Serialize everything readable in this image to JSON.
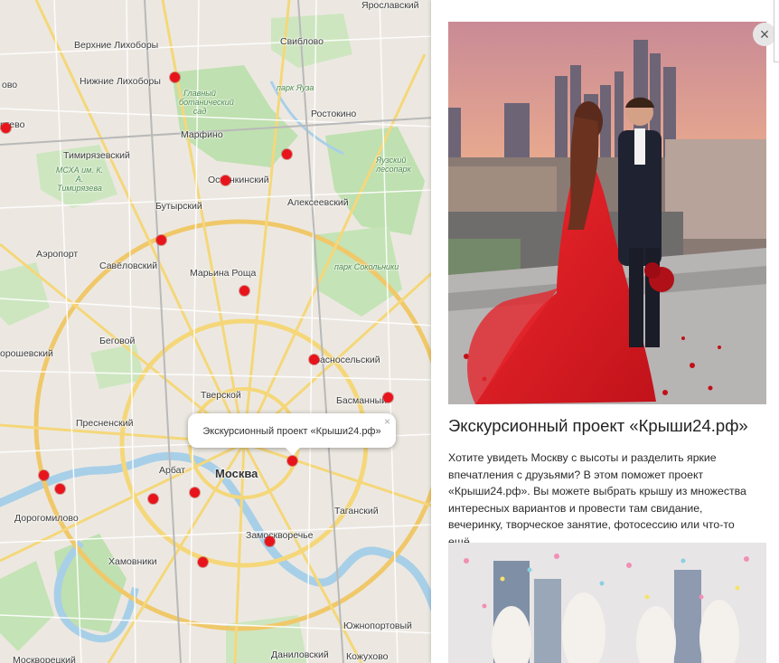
{
  "map": {
    "city_label": "Москва",
    "labels": [
      {
        "text": "Ярославский"
      },
      {
        "text": "Верхние Лихоборы"
      },
      {
        "text": "Свиблово"
      },
      {
        "text": "Нижние Лихоборы"
      },
      {
        "text": "ово"
      },
      {
        "text": "Главный ботанический сад"
      },
      {
        "text": "парк Яуза"
      },
      {
        "text": "Ростокино"
      },
      {
        "text": "ртево"
      },
      {
        "text": "Марфино"
      },
      {
        "text": "Тимирязевский"
      },
      {
        "text": "Останкинский"
      },
      {
        "text": "Яузский лесопарк"
      },
      {
        "text": "МСХА им. К. А. Тимирязева"
      },
      {
        "text": "Алексеевский"
      },
      {
        "text": "Бутырский"
      },
      {
        "text": "Аэропорт"
      },
      {
        "text": "Савёловский"
      },
      {
        "text": "Марьина Роща"
      },
      {
        "text": "парк Сокольники"
      },
      {
        "text": "Беговой"
      },
      {
        "text": "орошевский"
      },
      {
        "text": "Красносельский"
      },
      {
        "text": "Тверской"
      },
      {
        "text": "Басманный"
      },
      {
        "text": "Пресненский"
      },
      {
        "text": "Арбат"
      },
      {
        "text": "Таганский"
      },
      {
        "text": "Дорогомилово"
      },
      {
        "text": "Замоскворечье"
      },
      {
        "text": "Хамовники"
      },
      {
        "text": "Южнопортовый"
      },
      {
        "text": "Даниловский"
      },
      {
        "text": "Кожухово"
      },
      {
        "text": "Москворецкий"
      }
    ],
    "markers": 17
  },
  "popup": {
    "text": "Экскурсионный проект «Крыши24.рф»",
    "close": "×"
  },
  "panel": {
    "close": "×",
    "title": "Экскурсионный проект «Крыши24.рф»",
    "description": "Хотите увидеть Москву с высоты и разделить яркие впечатления с друзьями? В этом поможет проект «Крыши24.рф». Вы можете выбрать крышу из множества интересных вариантов и провести там свидание, вечеринку, творческое занятие, фотосессию или что-то ещё."
  }
}
